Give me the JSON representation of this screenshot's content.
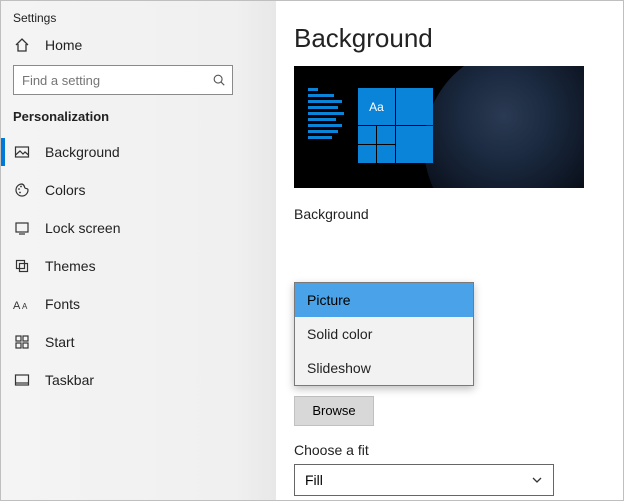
{
  "window": {
    "title": "Settings"
  },
  "sidebar": {
    "home_label": "Home",
    "search_placeholder": "Find a setting",
    "section_header": "Personalization",
    "items": [
      {
        "label": "Background",
        "icon": "picture-icon",
        "selected": true
      },
      {
        "label": "Colors",
        "icon": "palette-icon",
        "selected": false
      },
      {
        "label": "Lock screen",
        "icon": "lockscreen-icon",
        "selected": false
      },
      {
        "label": "Themes",
        "icon": "themes-icon",
        "selected": false
      },
      {
        "label": "Fonts",
        "icon": "fonts-icon",
        "selected": false
      },
      {
        "label": "Start",
        "icon": "start-icon",
        "selected": false
      },
      {
        "label": "Taskbar",
        "icon": "taskbar-icon",
        "selected": false
      }
    ]
  },
  "main": {
    "page_title": "Background",
    "preview_tile_text": "Aa",
    "background_label": "Background",
    "background_dropdown": {
      "open": true,
      "selected_index": 0,
      "options": [
        "Picture",
        "Solid color",
        "Slideshow"
      ]
    },
    "browse_label": "Browse",
    "choose_fit_label": "Choose a fit",
    "fit_dropdown": {
      "open": false,
      "selected": "Fill"
    }
  }
}
